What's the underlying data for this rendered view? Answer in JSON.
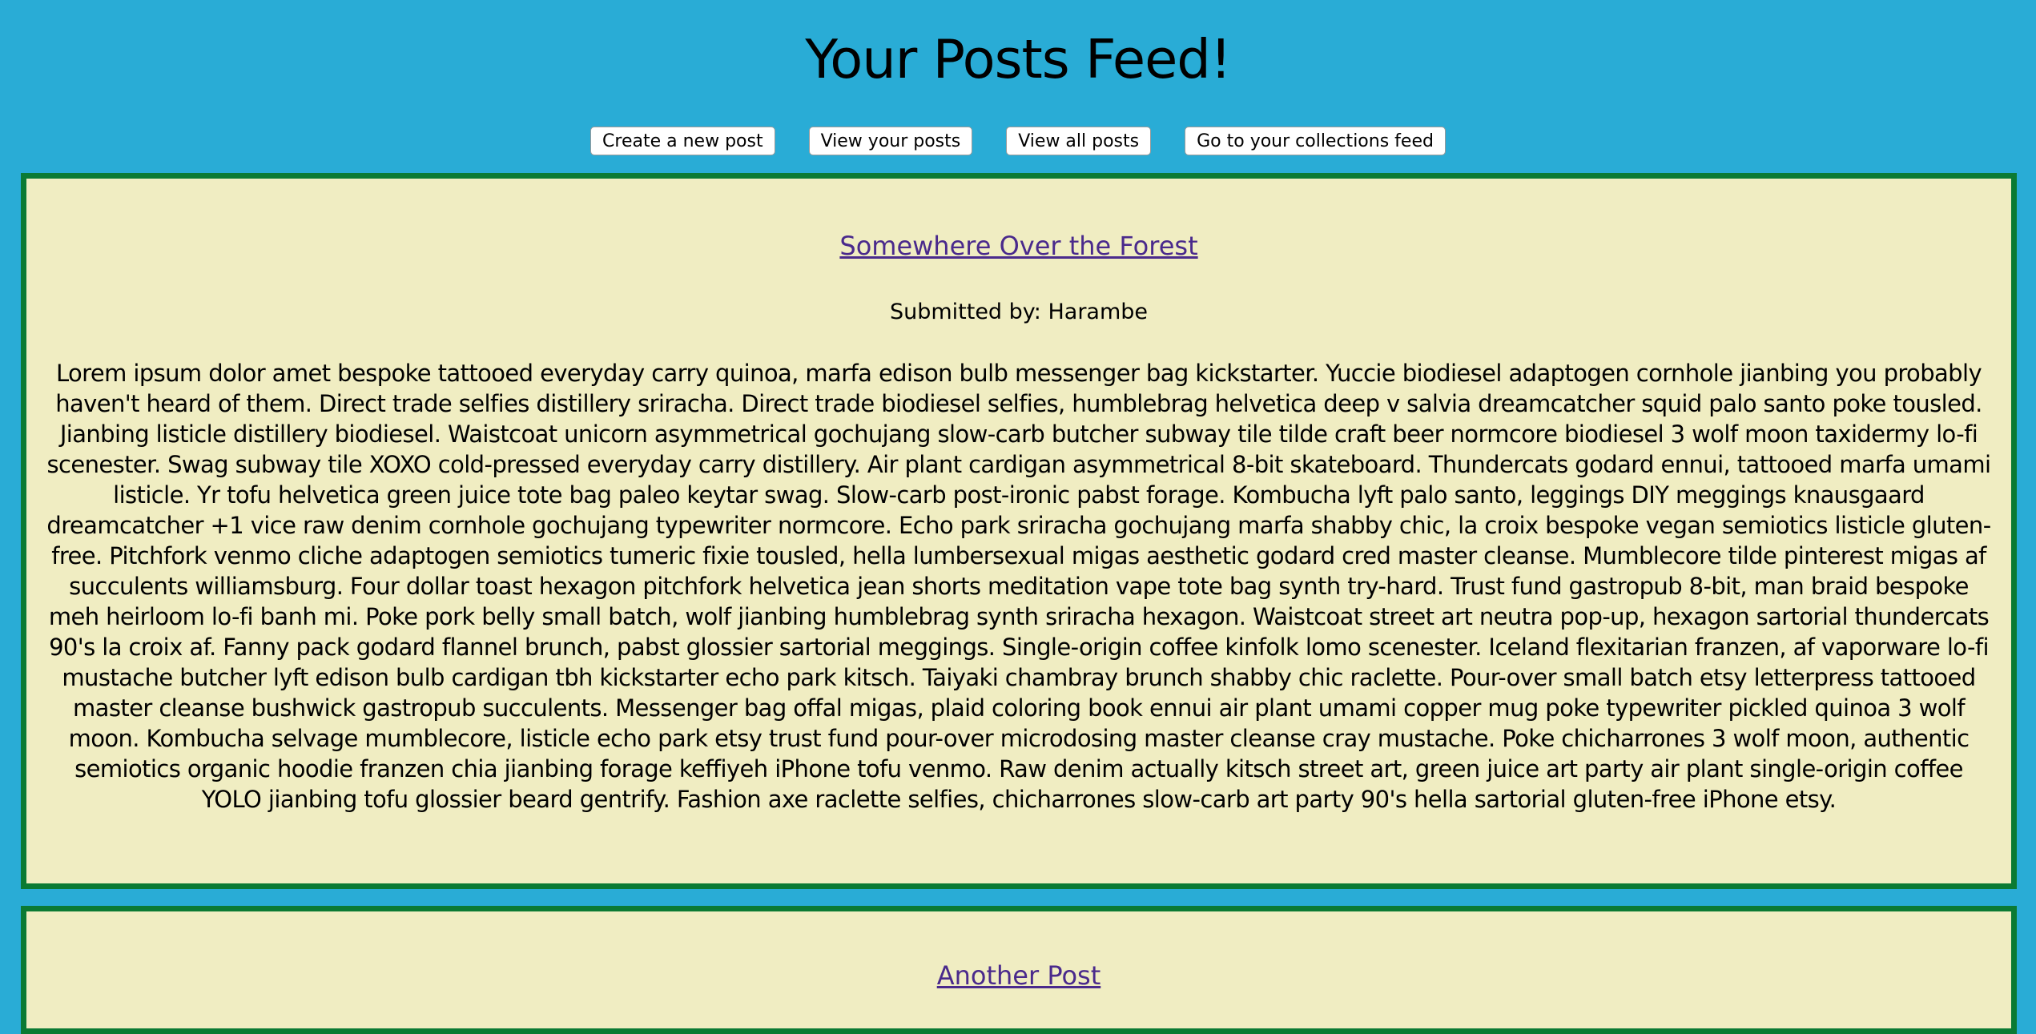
{
  "header": {
    "title": "Your Posts Feed!"
  },
  "nav": {
    "create_label": "Create a new post",
    "view_yours_label": "View your posts",
    "view_all_label": "View all posts",
    "collections_label": "Go to your collections feed"
  },
  "posts": [
    {
      "title": "Somewhere Over the Forest",
      "submitted_by": "Submitted by: Harambe",
      "body": "Lorem ipsum dolor amet bespoke tattooed everyday carry quinoa, marfa edison bulb messenger bag kickstarter. Yuccie biodiesel adaptogen cornhole jianbing you probably haven't heard of them. Direct trade selfies distillery sriracha. Direct trade biodiesel selfies, humblebrag helvetica deep v salvia dreamcatcher squid palo santo poke tousled. Jianbing listicle distillery biodiesel. Waistcoat unicorn asymmetrical gochujang slow-carb butcher subway tile tilde craft beer normcore biodiesel 3 wolf moon taxidermy lo-fi scenester. Swag subway tile XOXO cold-pressed everyday carry distillery. Air plant cardigan asymmetrical 8-bit skateboard. Thundercats godard ennui, tattooed marfa umami listicle. Yr tofu helvetica green juice tote bag paleo keytar swag. Slow-carb post-ironic pabst forage. Kombucha lyft palo santo, leggings DIY meggings knausgaard dreamcatcher +1 vice raw denim cornhole gochujang typewriter normcore. Echo park sriracha gochujang marfa shabby chic, la croix bespoke vegan semiotics listicle gluten-free. Pitchfork venmo cliche adaptogen semiotics tumeric fixie tousled, hella lumbersexual migas aesthetic godard cred master cleanse. Mumblecore tilde pinterest migas af succulents williamsburg. Four dollar toast hexagon pitchfork helvetica jean shorts meditation vape tote bag synth try-hard. Trust fund gastropub 8-bit, man braid bespoke meh heirloom lo-fi banh mi. Poke pork belly small batch, wolf jianbing humblebrag synth sriracha hexagon. Waistcoat street art neutra pop-up, hexagon sartorial thundercats 90's la croix af. Fanny pack godard flannel brunch, pabst glossier sartorial meggings. Single-origin coffee kinfolk lomo scenester. Iceland flexitarian franzen, af vaporware lo-fi mustache butcher lyft edison bulb cardigan tbh kickstarter echo park kitsch. Taiyaki chambray brunch shabby chic raclette. Pour-over small batch etsy letterpress tattooed master cleanse bushwick gastropub succulents. Messenger bag offal migas, plaid coloring book ennui air plant umami copper mug poke typewriter pickled quinoa 3 wolf moon. Kombucha selvage mumblecore, listicle echo park etsy trust fund pour-over microdosing master cleanse cray mustache. Poke chicharrones 3 wolf moon, authentic semiotics organic hoodie franzen chia jianbing forage keffiyeh iPhone tofu venmo. Raw denim actually kitsch street art, green juice art party air plant single-origin coffee YOLO jianbing tofu glossier beard gentrify. Fashion axe raclette selfies, chicharrones slow-carb art party 90's hella sartorial gluten-free iPhone etsy."
    },
    {
      "title": "Another Post"
    }
  ],
  "colors": {
    "page_background": "#29acd6",
    "post_background": "#f0edc2",
    "post_border": "#0b7a33",
    "link": "#4a2a8c"
  }
}
